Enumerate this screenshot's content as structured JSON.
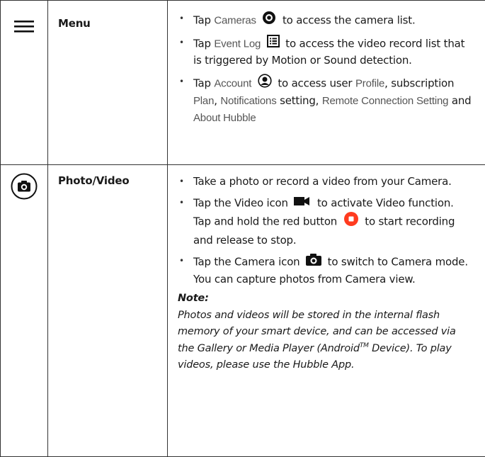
{
  "rows": {
    "menu": {
      "icon": "hamburger-menu-icon",
      "name": "Menu",
      "bullets": {
        "cameras": {
          "prefix": "Tap",
          "term": "Cameras",
          "icon": "cameras-target-icon",
          "suffix": "to access the camera list."
        },
        "event_log": {
          "prefix": "Tap",
          "term": "Event Log",
          "icon": "event-log-list-icon",
          "suffix": "to access the video record list that is triggered by Motion or Sound detection."
        },
        "account": {
          "prefix": "Tap",
          "term": "Account",
          "icon": "account-user-icon",
          "text1": "to access user",
          "term_profile": "Profile",
          "text2": ", subscription",
          "term_plan": "Plan",
          "text3": ",",
          "term_notifications": "Notifications",
          "text4": "setting,",
          "term_remote": "Remote Connection Setting",
          "text5": "and",
          "term_about": "About Hubble"
        }
      }
    },
    "photo_video": {
      "icon": "camera-circle-icon",
      "name": "Photo/Video",
      "bullets": {
        "take_photo": "Take a photo or record a video from your Camera.",
        "video": {
          "text1": "Tap the Video icon",
          "icon_video": "video-camera-icon",
          "text2": "to activate Video function. Tap and hold the red button",
          "icon_record": "record-button-icon",
          "text3": "to start recording and release to stop."
        },
        "camera": {
          "text1": "Tap the Camera icon",
          "icon_camera": "camera-icon",
          "text2": "to switch to Camera mode. You can capture photos from Camera view."
        }
      },
      "note": {
        "title": "Note:",
        "text1": "Photos and videos will be stored in the internal flash memory of your smart device, and can be accessed via the Gallery or Media Player (Android",
        "tm": "TM",
        "text2": " Device). To play videos, please use the Hubble App."
      }
    }
  },
  "colors": {
    "record_red": "#ff3b1f",
    "border": "#333333",
    "ui_term_gray": "#555555"
  }
}
